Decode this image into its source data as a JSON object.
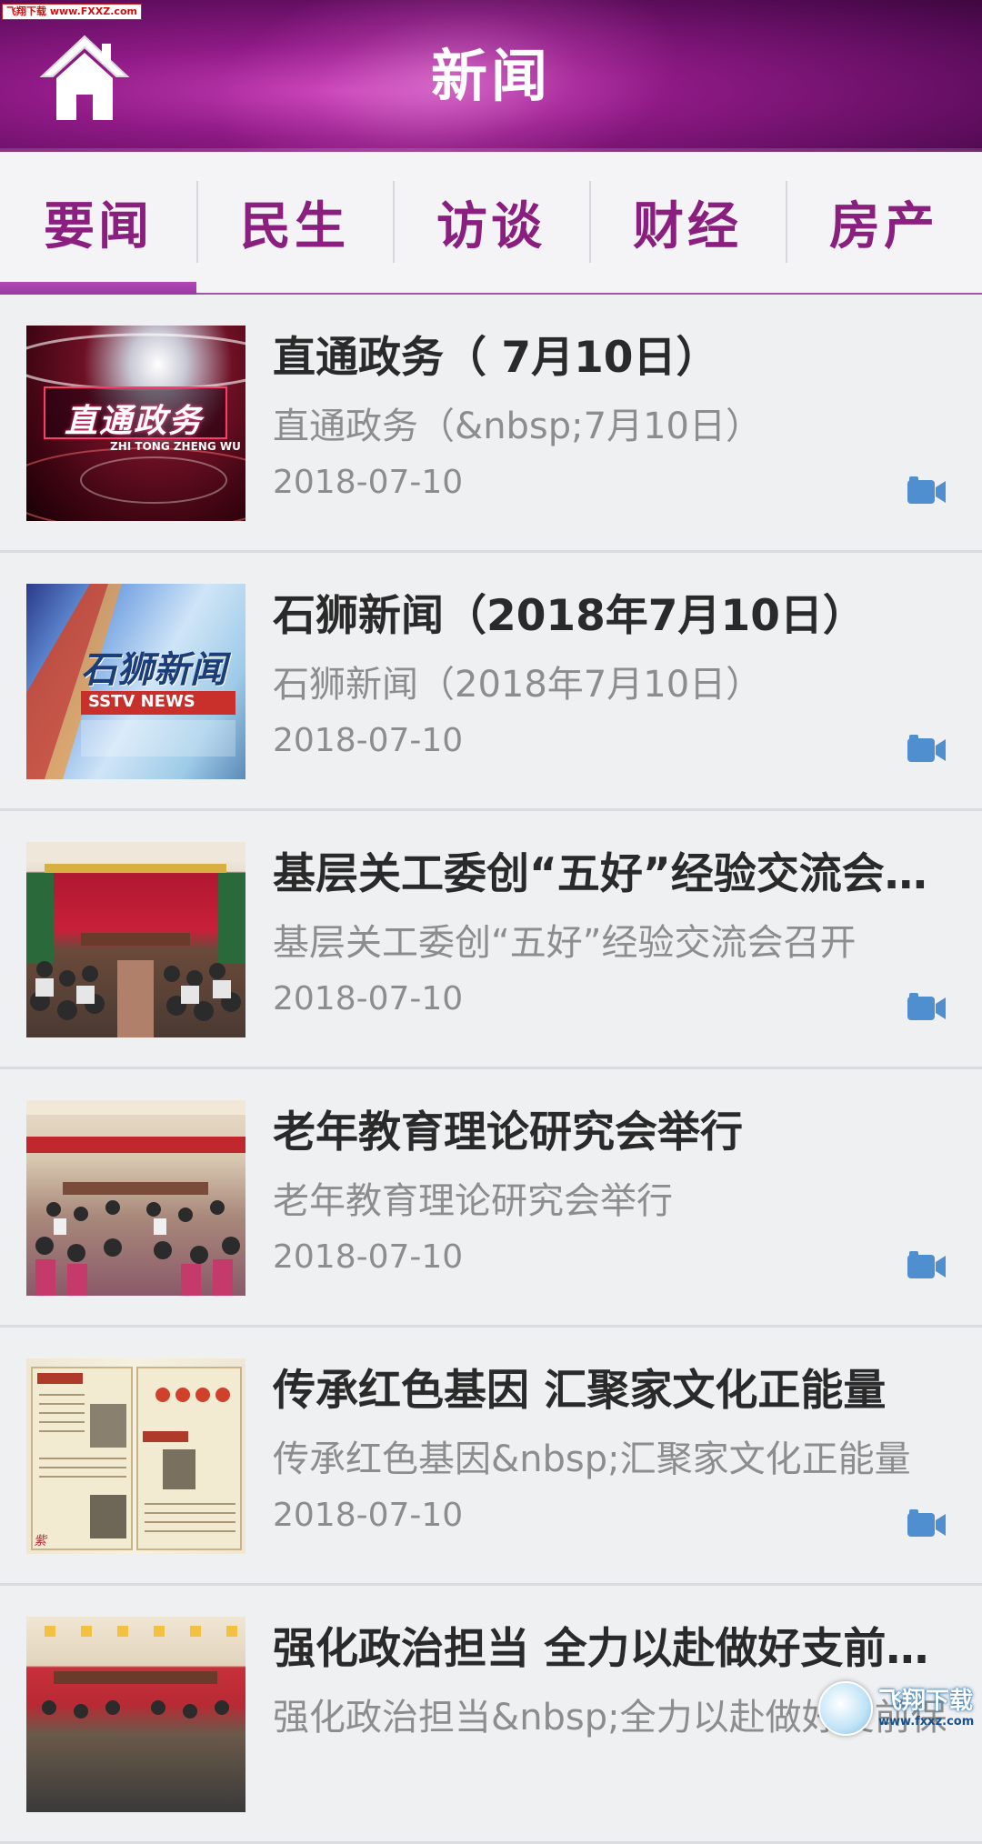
{
  "watermark_top": "飞翔下载 www.FXXZ.com",
  "header": {
    "title": "新闻",
    "home_icon": "home-icon"
  },
  "tabs": [
    {
      "label": "要闻",
      "active": true
    },
    {
      "label": "民生",
      "active": false
    },
    {
      "label": "访谈",
      "active": false
    },
    {
      "label": "财经",
      "active": false
    },
    {
      "label": "房产",
      "active": false
    }
  ],
  "news": [
    {
      "title": "直通政务（ 7月10日）",
      "summary": "直通政务（&nbsp;7月10日）",
      "date": "2018-07-10",
      "thumb_text": "直通政务",
      "thumb_subtext": "ZHI TONG ZHENG WU",
      "icon": "video-camera-icon"
    },
    {
      "title": "石狮新闻（2018年7月10日）",
      "summary": "石狮新闻（2018年7月10日）",
      "date": "2018-07-10",
      "thumb_text": "石狮新闻",
      "thumb_subtext": "SSTV NEWS",
      "icon": "video-camera-icon"
    },
    {
      "title": "基层关工委创“五好”经验交流会召开",
      "summary": "基层关工委创“五好”经验交流会召开",
      "date": "2018-07-10",
      "thumb_text": "",
      "thumb_subtext": "",
      "icon": "video-camera-icon"
    },
    {
      "title": "老年教育理论研究会举行",
      "summary": "老年教育理论研究会举行",
      "date": "2018-07-10",
      "thumb_text": "",
      "thumb_subtext": "",
      "icon": "video-camera-icon"
    },
    {
      "title": "传承红色基因 汇聚家文化正能量",
      "summary": "传承红色基因&nbsp;汇聚家文化正能量",
      "date": "2018-07-10",
      "thumb_text": "",
      "thumb_subtext": "",
      "icon": "video-camera-icon"
    },
    {
      "title": "强化政治担当 全力以赴做好支前保...",
      "summary": "强化政治担当&nbsp;全力以赴做好支前保障",
      "date": "",
      "thumb_text": "",
      "thumb_subtext": "",
      "icon": "video-camera-icon"
    }
  ],
  "watermark_br": {
    "name": "飞翔下载",
    "url": "www.fxxz.com"
  }
}
